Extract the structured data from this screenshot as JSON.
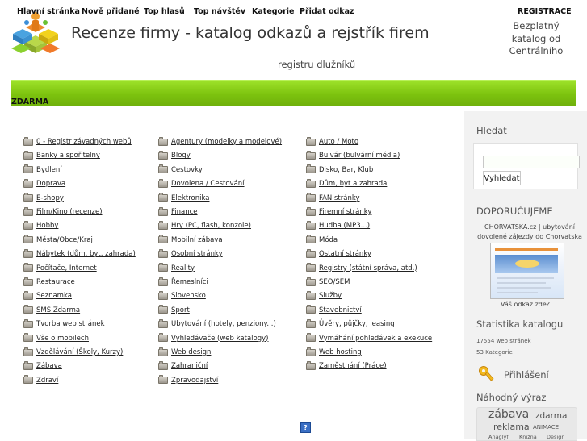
{
  "header": {
    "logo_icon": "people-blocks-logo-icon",
    "title": "Recenze firmy - katalog odkazů a rejstřík firem",
    "subtitle": "registru dlužníků",
    "corner_line1": "Bezplatný",
    "corner_line2": "katalog od",
    "corner_line3": "Centrálního"
  },
  "nav": {
    "items": [
      "Hlavní stránka",
      "Nově přidané",
      "Top hlasů",
      "Top návštěv",
      "Kategorie",
      "Přidat odkaz"
    ],
    "register_label": "REGISTRACE",
    "register_label_2": "ZDARMA",
    "bar_color": "#8fd31b"
  },
  "categories": {
    "folder_icon": "folder-icon",
    "col1": [
      "0 - Registr závadných webů",
      "Banky a spořitelny",
      "Bydlení",
      "Doprava",
      "E-shopy",
      "Film/Kino (recenze)",
      "Hobby",
      "Města/Obce/Kraj",
      "Nábytek (dům, byt, zahrada)",
      "Počítače, Internet",
      "Restaurace",
      "Seznamka",
      "SMS Zdarma",
      "Tvorba web stránek",
      "Vše o mobilech",
      "Vzdělávání (Školy, Kurzy)",
      "Zábava",
      "Zdraví"
    ],
    "col2": [
      "Agentury (modelky a modelové)",
      "Blogy",
      "Cestovky",
      "Dovolena / Cestování",
      "Elektronika",
      "Finance",
      "Hry (PC, flash, konzole)",
      "Mobilní zábava",
      "Osobní stránky",
      "Reality",
      "Řemeslníci",
      "Slovensko",
      "Sport",
      "Ubytování (hotely, penziony...)",
      "Vyhledávače (web katalogy)",
      "Web design",
      "Zahraniční",
      "Zpravodajství"
    ],
    "col3": [
      "Auto / Moto",
      "Bulvár (bulvární média)",
      "Disko, Bar, Klub",
      "Dům, byt a zahrada",
      "FAN stránky",
      "Firemní stránky",
      "Hudba (MP3...)",
      "Móda",
      "Ostatní stránky",
      "Registry (státní správa, atd.)",
      "SEO/SEM",
      "Služby",
      "Stavebnictví",
      "Úvěry, půjčky, leasing",
      "Vymáhání pohledávek a exekuce",
      "Web hosting",
      "Zaměstnání (Práce)"
    ]
  },
  "help_icon": {
    "name": "help-icon",
    "glyph": "?"
  },
  "sidebar": {
    "search_heading": "Hledat",
    "search_value": "",
    "search_button": "Vyhledat",
    "recommend_heading": "DOPORUČUJEME",
    "recommend_text_1": "CHORVATSKA.cz | ubytování",
    "recommend_text_2": "dovolené zájezdy do Chorvatska",
    "recommend_caption": "Váš odkaz zde?",
    "stats_heading": "Statistika katalogu",
    "stats_pages": "17554 web stránek",
    "stats_categories": "53 Kategorie",
    "login_icon": "key-icon",
    "login_label": "Přihlášení",
    "random_heading": "Náhodný výraz",
    "tags": [
      "zábava",
      "zdarma",
      "reklama",
      "ANIMACE",
      "Anaglyf",
      "Knižna",
      "Design"
    ]
  }
}
